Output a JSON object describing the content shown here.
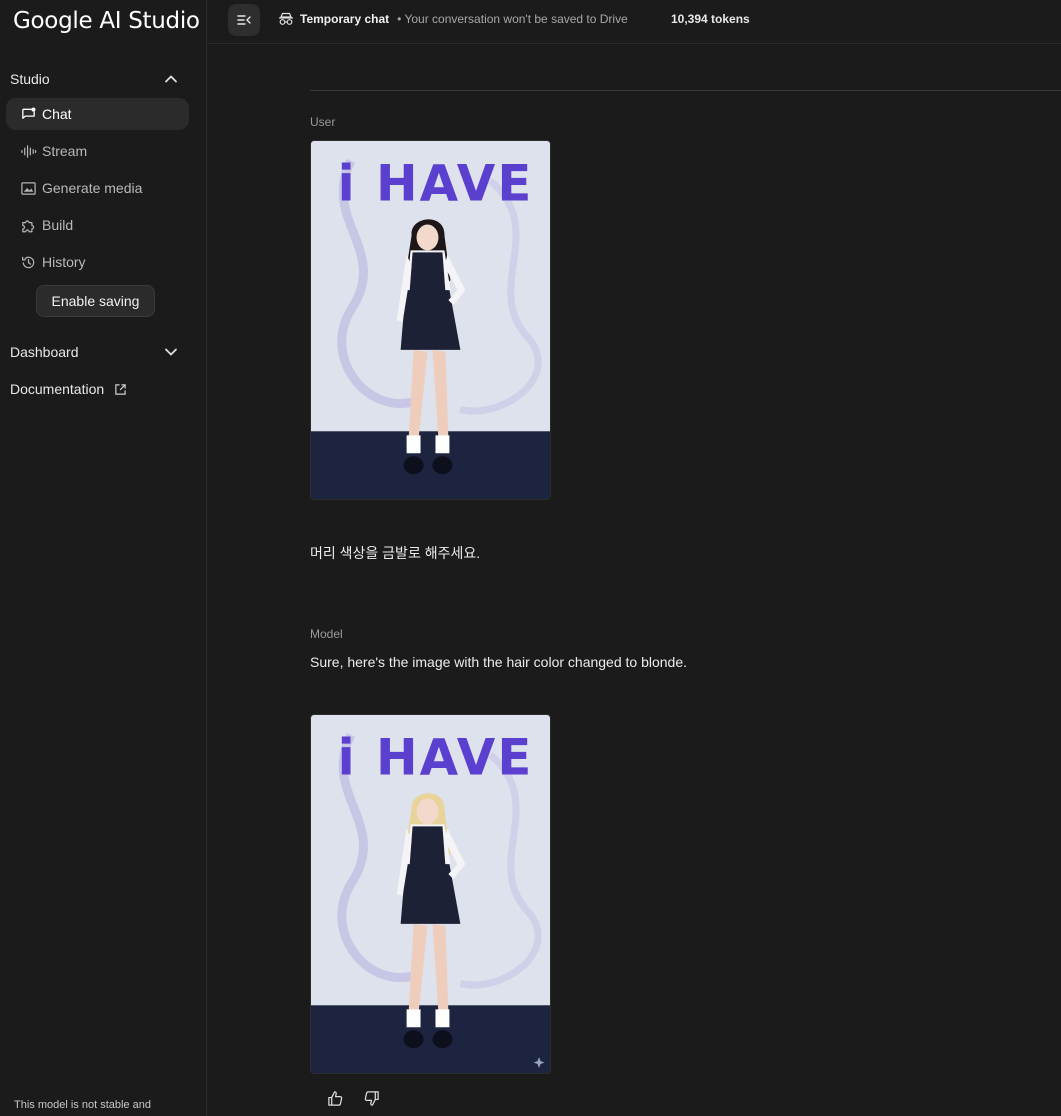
{
  "app": {
    "title": "Google AI Studio"
  },
  "sidebar": {
    "studio_label": "Studio",
    "items": [
      {
        "label": "Chat",
        "icon": "chat-icon",
        "active": true
      },
      {
        "label": "Stream",
        "icon": "stream-icon",
        "active": false
      },
      {
        "label": "Generate media",
        "icon": "generate-media-icon",
        "active": false
      },
      {
        "label": "Build",
        "icon": "build-icon",
        "active": false
      },
      {
        "label": "History",
        "icon": "history-icon",
        "active": false
      }
    ],
    "enable_saving": "Enable saving",
    "dashboard_label": "Dashboard",
    "documentation_label": "Documentation",
    "footer_note": "This model is not stable and"
  },
  "topbar": {
    "temporary_chat": "Temporary chat",
    "temporary_note": "• Your conversation won't be saved to Drive",
    "tokens": "10,394 tokens"
  },
  "chat": {
    "user_role": "User",
    "user_message": "머리 색상을 금발로 해주세요.",
    "model_role": "Model",
    "model_message": "Sure, here's the image with the hair color changed to blonde.",
    "poster_text": "i HAVE",
    "original_hair_color": "#1e1719",
    "edited_hair_color": "#e8d39a"
  },
  "colors": {
    "background": "#1b1b1b",
    "active_item": "#2b2b2b",
    "poster_background": "#dde2ec",
    "poster_floor": "#1d2440",
    "poster_title": "#5b3fcf"
  }
}
